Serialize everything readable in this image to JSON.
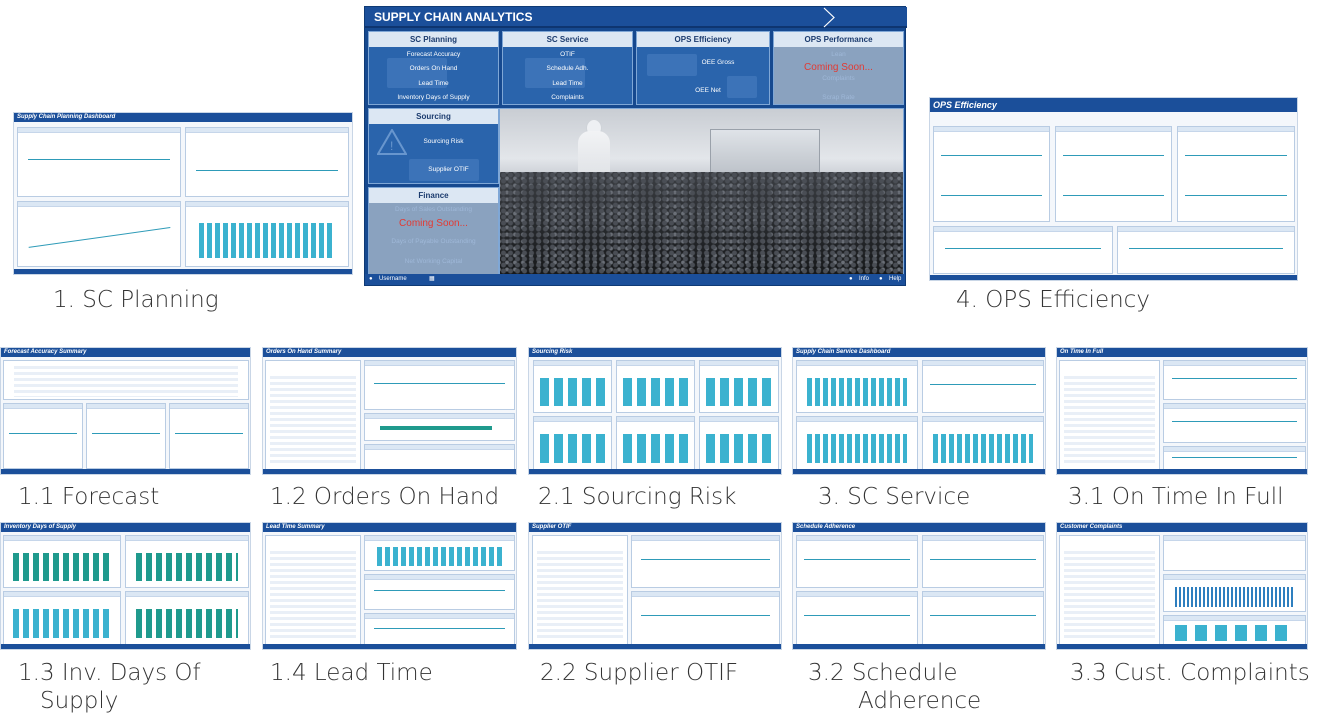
{
  "main": {
    "title": "SUPPLY CHAIN ANALYTICS",
    "tiles": {
      "planning": {
        "header": "SC Planning",
        "items": [
          "Forecast Accuracy",
          "Orders On Hand",
          "Lead Time",
          "Inventory Days of Supply"
        ]
      },
      "service": {
        "header": "SC Service",
        "items": [
          "OTIF",
          "Schedule Adh.",
          "Lead Time",
          "Complaints"
        ]
      },
      "ops_eff": {
        "header": "OPS Efficiency",
        "items": [
          "OEE Gross",
          "OEE Net"
        ]
      },
      "ops_perf": {
        "header": "OPS Performance",
        "items": [
          "Lean",
          "Complaints",
          "Scrap Rate"
        ],
        "coming_soon": "Coming Soon..."
      },
      "sourcing": {
        "header": "Sourcing",
        "items": [
          "Sourcing Risk",
          "Supplier OTIF"
        ]
      },
      "finance": {
        "header": "Finance",
        "items": [
          "Days of Sales Outstanding",
          "Days of Payable Outstanding",
          "Net Working Capital"
        ],
        "coming_soon": "Coming Soon..."
      }
    },
    "footer": {
      "username": "Username",
      "info": "Info",
      "help": "Help"
    }
  },
  "thumbs": {
    "sc_planning": {
      "title": "Supply Chain Planning Dashboard",
      "caption": "1. SC Planning"
    },
    "ops_efficiency": {
      "title": "OPS Efficiency",
      "caption": "4. OPS Efficiency"
    },
    "forecast": {
      "title": "Forecast Accuracy Summary",
      "caption": "1.1 Forecast"
    },
    "orders": {
      "title": "Orders On Hand Summary",
      "caption": "1.2 Orders On Hand"
    },
    "sourcing_risk": {
      "title": "Sourcing Risk",
      "caption": "2.1 Sourcing Risk"
    },
    "sc_service": {
      "title": "Supply Chain Service Dashboard",
      "caption": "3. SC Service"
    },
    "otif": {
      "title": "On Time In Full",
      "caption": "3.1 On Time In Full"
    },
    "inv_days": {
      "title": "Inventory Days of Supply",
      "caption1": "1.3 Inv. Days Of",
      "caption2": "Supply"
    },
    "lead_time": {
      "title": "Lead Time Summary",
      "caption": "1.4 Lead Time"
    },
    "supplier_otif": {
      "title": "Supplier OTIF",
      "caption": "2.2 Supplier OTIF"
    },
    "schedule": {
      "title": "Schedule Adherence",
      "caption1": "3.2 Schedule",
      "caption2": "Adherence"
    },
    "complaints": {
      "title": "Customer Complaints",
      "caption": "3.3 Cust. Complaints"
    }
  },
  "colors": {
    "brand": "#1b4f9a",
    "accent": "#3bb2cf",
    "alert": "#e23a33"
  }
}
